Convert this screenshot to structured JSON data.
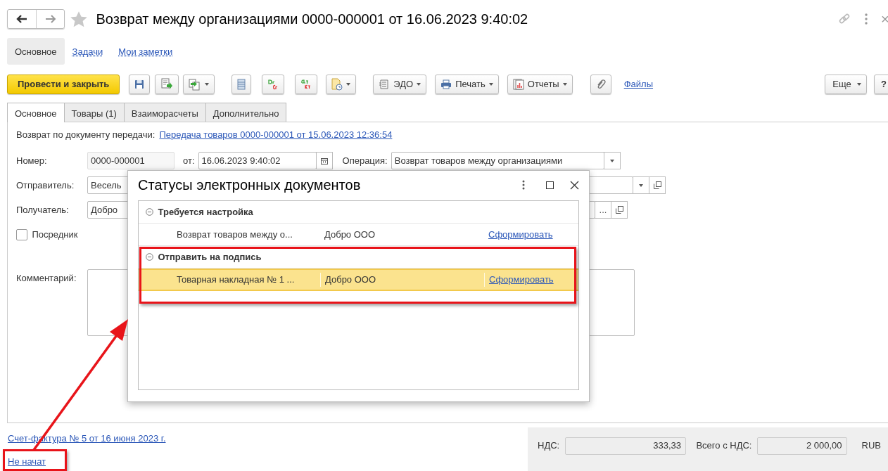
{
  "window": {
    "title": "Возврат между организациями 0000-000001 от 16.06.2023 9:40:02",
    "close": "×"
  },
  "section_nav": [
    {
      "label": "Основное",
      "selected": true
    },
    {
      "label": "Задачи",
      "selected": false
    },
    {
      "label": "Мои заметки",
      "selected": false
    }
  ],
  "toolbar": {
    "post_button": "Провести и закрыть",
    "edo_button": "ЭДО",
    "print_button": "Печать",
    "reports_button": "Отчеты",
    "files_link": "Файлы",
    "more_button": "Еще",
    "help_button": "?"
  },
  "form_tabs": [
    {
      "label": "Основное",
      "selected": true
    },
    {
      "label": "Товары (1)",
      "selected": false
    },
    {
      "label": "Взаиморасчеты",
      "selected": false
    },
    {
      "label": "Дополнительно",
      "selected": false
    }
  ],
  "form": {
    "basis_label": "Возврат по документу передачи:",
    "basis_link": "Передача товаров 0000-000001 от 15.06.2023 12:36:54",
    "number_label": "Номер:",
    "number_value": "0000-000001",
    "date_label": "от:",
    "date_value": "16.06.2023  9:40:02",
    "operation_label": "Операция:",
    "operation_value": "Возврат товаров между организациями",
    "sender_label": "Отправитель:",
    "sender_value": "Весель",
    "recipient_label": "Получатель:",
    "recipient_value": "Добро",
    "recipient_select": "...",
    "intermediary": {
      "label": "Посредник",
      "checked": false
    },
    "comment_label": "Комментарий:"
  },
  "dialog": {
    "title": "Статусы электронных документов",
    "groups": [
      {
        "title": "Требуется настройка",
        "expanded": true,
        "rows": [
          {
            "document": "Возврат товаров между о...",
            "organization": "Добро ООО",
            "action": "Сформировать",
            "selected": false
          }
        ]
      },
      {
        "title": "Отправить на подпись",
        "expanded": true,
        "rows": [
          {
            "document": "Товарная накладная № 1 ...",
            "organization": "Добро ООО",
            "action": "Сформировать",
            "selected": true
          }
        ]
      }
    ]
  },
  "footer": {
    "invoice_link": "Счет-фактура № 5 от 16 июня 2023 г.",
    "edo_status_link": "Не начат",
    "totals": {
      "vat_label": "НДС:",
      "vat_value": "333,33",
      "total_label": "Всего с НДС:",
      "total_value": "2 000,00",
      "currency": "RUB"
    }
  }
}
